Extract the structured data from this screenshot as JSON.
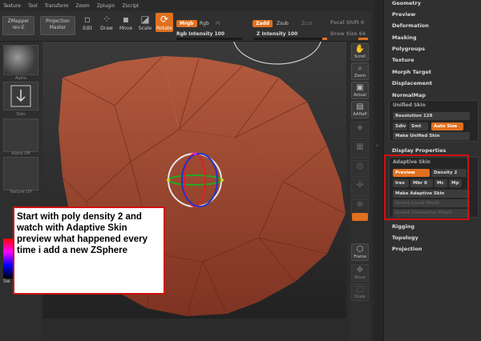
{
  "menu": [
    "Texture",
    "Tool",
    "Transform",
    "Zoom",
    "Zplugin",
    "Zscript"
  ],
  "toolbar": {
    "zmapper": "ZMapper",
    "zmapper_sub": "rev-E",
    "projection": "Projection",
    "projection_sub": "Master",
    "edit": "Edit",
    "draw": "Draw",
    "move": "Move",
    "scale": "Scale",
    "rotate": "Rotate",
    "mrgb": "Mrgb",
    "rgb": "Rgb",
    "m": "M",
    "rgb_intensity_label": "Rgb Intensity 100",
    "zadd": "Zadd",
    "zsub": "Zsub",
    "zcut": "Zcut",
    "z_intensity_label": "Z Intensity 100",
    "focal_shift": "Focal Shift 0",
    "draw_size": "Draw Size 64"
  },
  "left_shelf": {
    "tile1": "Alpha",
    "tile2": "Dots",
    "tile3": "Alpha Off",
    "tile4": "Texture Off",
    "bottom": "Sw"
  },
  "right_shelf": {
    "scroll": "Scroll",
    "zoom": "Zoom",
    "actual": "Actual",
    "aahalf": "AAHalf",
    "frame": "Frame",
    "move": "Move",
    "scale": "Scale"
  },
  "palette": {
    "items": [
      "Geometry",
      "Preview",
      "Deformation",
      "Masking",
      "Polygroups",
      "Texture",
      "Morph Target",
      "Displacement",
      "NormalMap"
    ],
    "unified_skin": {
      "title": "Unified Skin",
      "resolution": "Resolution 128",
      "sdiv": "Sdiv",
      "smt": "Smt",
      "auto_size": "Auto Size",
      "make": "Make Unified Skin"
    },
    "display_properties": "Display Properties",
    "adaptive_skin": {
      "title": "Adaptive Skin",
      "preview": "Preview",
      "density": "Density 2",
      "ires": "Ires",
      "mbr": "Mbr 0",
      "mc": "Mc",
      "mp": "Mp",
      "make": "Make Adaptive Skin",
      "insert_local": "Insert Local Mesh",
      "insert_connector": "Insert Connector Mesh"
    },
    "bottom_items": [
      "Rigging",
      "Topology",
      "Projection"
    ]
  },
  "note": {
    "text": "Start with poly density 2 and watch with Adaptive Skin preview what happened  every time i add a new ZSphere"
  },
  "colors": {
    "accent": "#e07020",
    "mesh": "#a3492f",
    "highlight": "#d01010"
  }
}
